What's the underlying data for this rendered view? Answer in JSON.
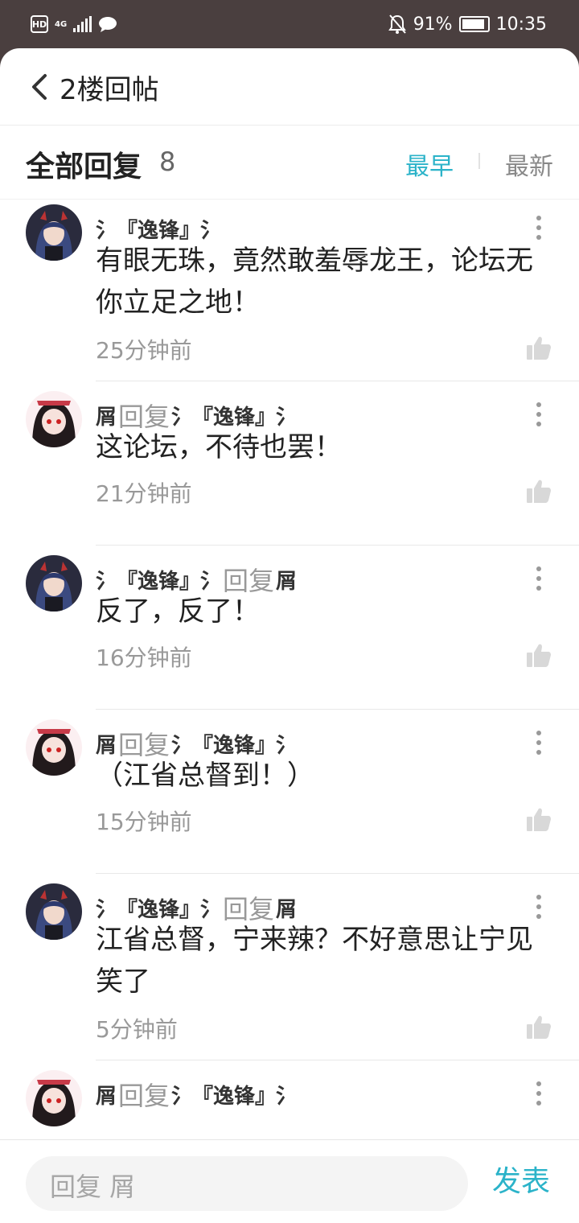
{
  "status_bar": {
    "hd": "HD",
    "network": "4G",
    "battery_percent": "91%",
    "battery_level": 0.91,
    "time": "10:35"
  },
  "header": {
    "title": "2楼回帖"
  },
  "section": {
    "title": "全部回复",
    "count": "8",
    "sort_earliest": "最早",
    "sort_latest": "最新",
    "active_sort_color": "#2bb3c9"
  },
  "reply_word": "回复",
  "replies": [
    {
      "author": "氵『逸锋』氵",
      "target": "",
      "content": "有眼无珠，竟然敢羞辱龙王，论坛无你立足之地！",
      "time": "25分钟前",
      "avatar": "user-avatar-dark"
    },
    {
      "author": "屑",
      "target": "氵『逸锋』氵",
      "content": "这论坛，不待也罢！",
      "time": "21分钟前",
      "avatar": "user-avatar-red"
    },
    {
      "author": "氵『逸锋』氵",
      "target": "屑",
      "content": "反了，反了！",
      "time": "16分钟前",
      "avatar": "user-avatar-dark"
    },
    {
      "author": "屑",
      "target": "氵『逸锋』氵",
      "content": "（江省总督到！）",
      "time": "15分钟前",
      "avatar": "user-avatar-red"
    },
    {
      "author": "氵『逸锋』氵",
      "target": "屑",
      "content": "江省总督，宁来辣？不好意思让宁见笑了",
      "time": "5分钟前",
      "avatar": "user-avatar-dark"
    },
    {
      "author": "屑",
      "target": "氵『逸锋』氵",
      "content": "",
      "time": "",
      "avatar": "user-avatar-red"
    }
  ],
  "composer": {
    "placeholder": "回复 屑",
    "send_label": "发表"
  }
}
